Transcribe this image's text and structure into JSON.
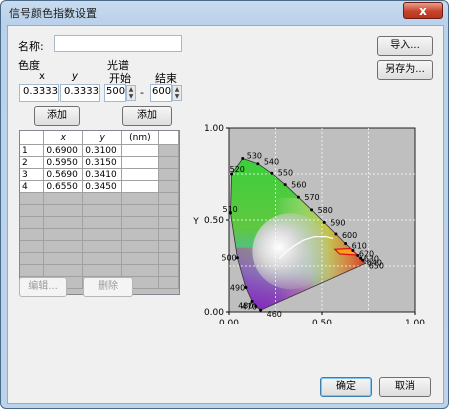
{
  "window": {
    "title": "信号颜色指数设置",
    "close_label": "x"
  },
  "name_field": {
    "label": "名称:",
    "value": ""
  },
  "chromaticity": {
    "label": "色度",
    "x_header": "x",
    "y_header": "y",
    "x_value": "0.3333",
    "y_value": "0.3333",
    "add_label": "添加"
  },
  "spectrum": {
    "label": "光谱",
    "start_label": "开始",
    "end_label": "结束",
    "start_value": "500",
    "end_value": "600",
    "separator": "-",
    "add_label": "添加"
  },
  "buttons": {
    "import": "导入...",
    "save_as": "另存为...",
    "edit": "编辑...",
    "delete": "删除",
    "ok": "确定",
    "cancel": "取消"
  },
  "table": {
    "headers": [
      "",
      "x",
      "y",
      "(nm)"
    ],
    "rows": [
      [
        "1",
        "0.6900",
        "0.3100",
        ""
      ],
      [
        "2",
        "0.5950",
        "0.3150",
        ""
      ],
      [
        "3",
        "0.5690",
        "0.3410",
        ""
      ],
      [
        "4",
        "0.6550",
        "0.3450",
        ""
      ]
    ]
  },
  "chart_data": {
    "type": "scatter",
    "title": "",
    "xlabel": "",
    "ylabel": "Y",
    "xlim": [
      0,
      1
    ],
    "ylim": [
      0,
      1
    ],
    "x_tick_labels": [
      "0.00",
      "0.50",
      "1.00"
    ],
    "y_tick_labels": [
      "0.00",
      "0.50",
      "1.00"
    ],
    "grid": true,
    "wavelength_labels": [
      "460",
      "470",
      "480",
      "490",
      "500",
      "510",
      "520",
      "530",
      "540",
      "550",
      "560",
      "570",
      "580",
      "590",
      "600",
      "610",
      "620",
      "630",
      "640",
      "650"
    ],
    "locus": [
      [
        0.17,
        0.01
      ],
      [
        0.144,
        0.03
      ],
      [
        0.124,
        0.058
      ],
      [
        0.091,
        0.133
      ],
      [
        0.045,
        0.295
      ],
      [
        0.008,
        0.538
      ],
      [
        0.014,
        0.75
      ],
      [
        0.074,
        0.834
      ],
      [
        0.155,
        0.806
      ],
      [
        0.23,
        0.754
      ],
      [
        0.302,
        0.692
      ],
      [
        0.373,
        0.624
      ],
      [
        0.444,
        0.555
      ],
      [
        0.512,
        0.487
      ],
      [
        0.575,
        0.424
      ],
      [
        0.627,
        0.372
      ],
      [
        0.666,
        0.334
      ],
      [
        0.692,
        0.308
      ],
      [
        0.708,
        0.292
      ],
      [
        0.719,
        0.281
      ],
      [
        0.735,
        0.265
      ]
    ],
    "planckian_locus": [
      [
        0.27,
        0.29
      ],
      [
        0.31,
        0.33
      ],
      [
        0.35,
        0.36
      ],
      [
        0.4,
        0.39
      ],
      [
        0.46,
        0.41
      ],
      [
        0.52,
        0.41
      ],
      [
        0.56,
        0.4
      ]
    ],
    "signal_polygon": [
      [
        0.69,
        0.31
      ],
      [
        0.595,
        0.315
      ],
      [
        0.569,
        0.341
      ],
      [
        0.655,
        0.345
      ]
    ]
  }
}
